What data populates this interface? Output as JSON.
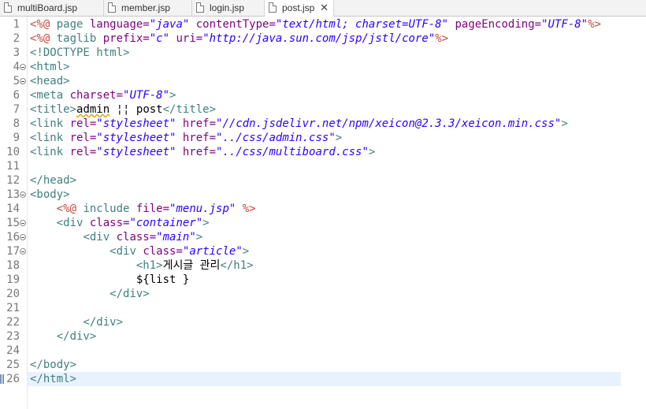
{
  "tabs": [
    {
      "label": "multiBoard.jsp"
    },
    {
      "label": "member.jsp"
    },
    {
      "label": "login.jsp"
    },
    {
      "label": "post.jsp",
      "active": true
    }
  ],
  "code": {
    "line1": {
      "num": "1",
      "p1": "<%@ ",
      "p2": "page ",
      "p3": "language=",
      "p4": "\"java\"",
      "p5": " contentType=",
      "p6": "\"text/html; charset=UTF-8\"",
      "p7": " pageEncoding=",
      "p8": "\"UTF-8\"",
      "p9": "%>"
    },
    "line2": {
      "num": "2",
      "p1": "<%@ ",
      "p2": "taglib ",
      "p3": "prefix=",
      "p4": "\"c\"",
      "p5": " uri=",
      "p6": "\"http://java.sun.com/jsp/jstl/core\"",
      "p7": "%>"
    },
    "line3": {
      "num": "3",
      "p1": "<!DOCTYPE html>"
    },
    "line4": {
      "num": "4",
      "p1": "<html>"
    },
    "line5": {
      "num": "5",
      "p1": "<head>"
    },
    "line6": {
      "num": "6",
      "p1": "<meta ",
      "p2": "charset=",
      "p3": "\"UTF-8\"",
      "p4": ">"
    },
    "line7": {
      "num": "7",
      "p1": "<title>",
      "p2": "admin",
      "p3": " ¦¦ post",
      "p4": "</title>"
    },
    "line8": {
      "num": "8",
      "p1": "<link ",
      "p2": "rel=",
      "p3": "\"stylesheet\"",
      "p4": " href=",
      "p5": "\"//cdn.jsdelivr.net/npm/xeicon@2.3.3/xeicon.min.css\"",
      "p6": ">"
    },
    "line9": {
      "num": "9",
      "p1": "<link ",
      "p2": "rel=",
      "p3": "\"stylesheet\"",
      "p4": " href=",
      "p5": "\"../css/admin.css\"",
      "p6": ">"
    },
    "line10": {
      "num": "10",
      "p1": "<link ",
      "p2": "rel=",
      "p3": "\"stylesheet\"",
      "p4": " href=",
      "p5": "\"../css/multiboard.css\"",
      "p6": ">"
    },
    "line11": {
      "num": "11"
    },
    "line12": {
      "num": "12",
      "p1": "</head>"
    },
    "line13": {
      "num": "13",
      "p1": "<body>"
    },
    "line14": {
      "num": "14",
      "p1": "    ",
      "p2": "<%@ ",
      "p3": "include ",
      "p4": "file=",
      "p5": "\"menu.jsp\"",
      "p6": " %>"
    },
    "line15": {
      "num": "15",
      "p1": "    ",
      "p2": "<div ",
      "p3": "class=",
      "p4": "\"container\"",
      "p5": ">"
    },
    "line16": {
      "num": "16",
      "p1": "        ",
      "p2": "<div ",
      "p3": "class=",
      "p4": "\"main\"",
      "p5": ">"
    },
    "line17": {
      "num": "17",
      "p1": "            ",
      "p2": "<div ",
      "p3": "class=",
      "p4": "\"article\"",
      "p5": ">"
    },
    "line18": {
      "num": "18",
      "p1": "                ",
      "p2": "<h1>",
      "p3": "게시글 관리",
      "p4": "</h1>"
    },
    "line19": {
      "num": "19",
      "p1": "                ",
      "p2": "${list }"
    },
    "line20": {
      "num": "20",
      "p1": "            ",
      "p2": "</div>"
    },
    "line21": {
      "num": "21"
    },
    "line22": {
      "num": "22",
      "p1": "        ",
      "p2": "</div>"
    },
    "line23": {
      "num": "23",
      "p1": "    ",
      "p2": "</div>"
    },
    "line24": {
      "num": "24"
    },
    "line25": {
      "num": "25",
      "p1": "</body>"
    },
    "line26": {
      "num": "26",
      "p1": "</html>"
    }
  },
  "icons": {
    "file": "file-icon",
    "close": "close-icon",
    "fold": "fold-minus-icon"
  },
  "colors": {
    "tag": "#3f7f7f",
    "attr": "#7f007f",
    "value": "#2a00ff",
    "directive": "#c5483b",
    "current_line": "#e8f2fe"
  }
}
